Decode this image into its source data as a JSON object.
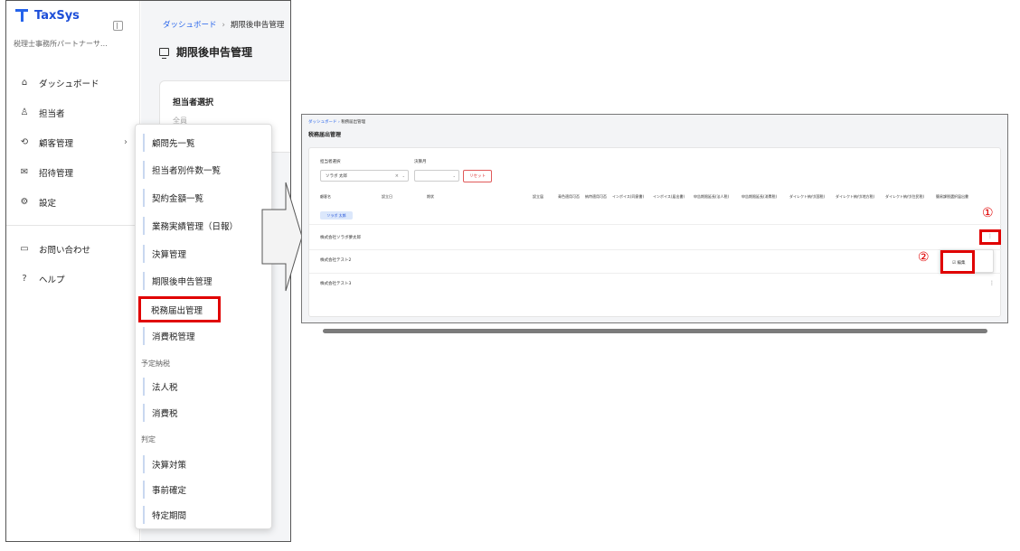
{
  "app": {
    "brand": "TaxSys",
    "org": "税理士事務所パートナーサ…",
    "nav": [
      {
        "label": "ダッシュボード",
        "icon": "home-icon"
      },
      {
        "label": "担当者",
        "icon": "user-icon"
      },
      {
        "label": "顧客管理",
        "icon": "handshake-icon"
      },
      {
        "label": "招待管理",
        "icon": "mail-icon"
      },
      {
        "label": "設定",
        "icon": "gear-icon"
      },
      {
        "label": "お問い合わせ",
        "icon": "chat-icon"
      },
      {
        "label": "ヘルプ",
        "icon": "help-icon"
      }
    ],
    "breadcrumb": {
      "home": "ダッシュボード",
      "sep": "›",
      "current": "期限後申告管理"
    },
    "page_title": "期限後申告管理",
    "card": {
      "label": "担当者選択",
      "input": "全員"
    },
    "submenu": {
      "items": [
        "顧問先一覧",
        "担当者別件数一覧",
        "契約金額一覧",
        "業務実績管理（日報）",
        "決算管理",
        "期限後申告管理",
        "税務届出管理",
        "消費税管理"
      ],
      "group1": "予定納税",
      "group1_items": [
        "法人税",
        "消費税"
      ],
      "group2": "判定",
      "group2_items": [
        "決算対策",
        "事前確定",
        "特定期間"
      ]
    }
  },
  "shot": {
    "breadcrumb": {
      "home": "ダッシュボード",
      "sep": "›",
      "current": "税務届出管理"
    },
    "title": "税務届出管理",
    "filter": {
      "staff_label": "担当者選択",
      "staff_value": "ソラボ 太郎",
      "month_label": "決算月",
      "reset": "リセット"
    },
    "headers": [
      "顧客名",
      "設立日",
      "期状",
      "設立届",
      "青色適用可否",
      "納特適用可否",
      "インボイス(同意書)",
      "インボイス(届出書)",
      "申告期限延長(法人税)",
      "申告期限延長(消費税)",
      "ダイレクト納付(国税)",
      "ダイレクト納付(地方税)",
      "ダイレクト納付(住民税)",
      "簡易課税選択届出書"
    ],
    "chip": "ソラボ 太郎",
    "rows": [
      "株式会社ソラボ夢太郎",
      "株式会社テスト2",
      "株式会社テスト3"
    ],
    "edit_label": "編集",
    "marker1": "①",
    "marker2": "②"
  }
}
